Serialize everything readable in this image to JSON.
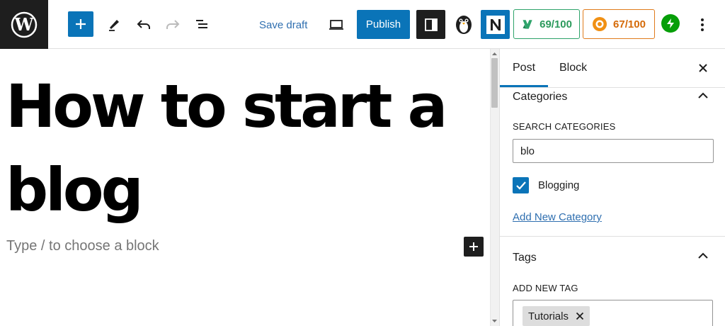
{
  "toolbar": {
    "save_draft_label": "Save draft",
    "publish_label": "Publish",
    "seo_score": "69/100",
    "readability_score": "67/100",
    "accent_color": "#0a74b8",
    "icons": [
      "wordpress-logo-icon",
      "plus-icon",
      "pencil-icon",
      "undo-icon",
      "redo-icon",
      "list-view-icon",
      "desktop-preview-icon",
      "sidebar-toggle-icon",
      "penguin-icon",
      "n-plugin-icon",
      "seo-score-icon",
      "readability-score-icon",
      "bolt-icon",
      "more-options-icon"
    ]
  },
  "editor": {
    "title": "How to start a blog",
    "placeholder": "Type / to choose a block"
  },
  "sidebar": {
    "tabs": [
      {
        "label": "Post",
        "active": true
      },
      {
        "label": "Block",
        "active": false
      }
    ],
    "categories": {
      "title": "Categories",
      "search_label": "SEARCH CATEGORIES",
      "search_value": "blo",
      "items": [
        {
          "label": "Blogging",
          "checked": true
        }
      ],
      "add_link": "Add New Category"
    },
    "tags": {
      "title": "Tags",
      "add_label": "ADD NEW TAG",
      "chips": [
        "Tutorials"
      ]
    }
  }
}
